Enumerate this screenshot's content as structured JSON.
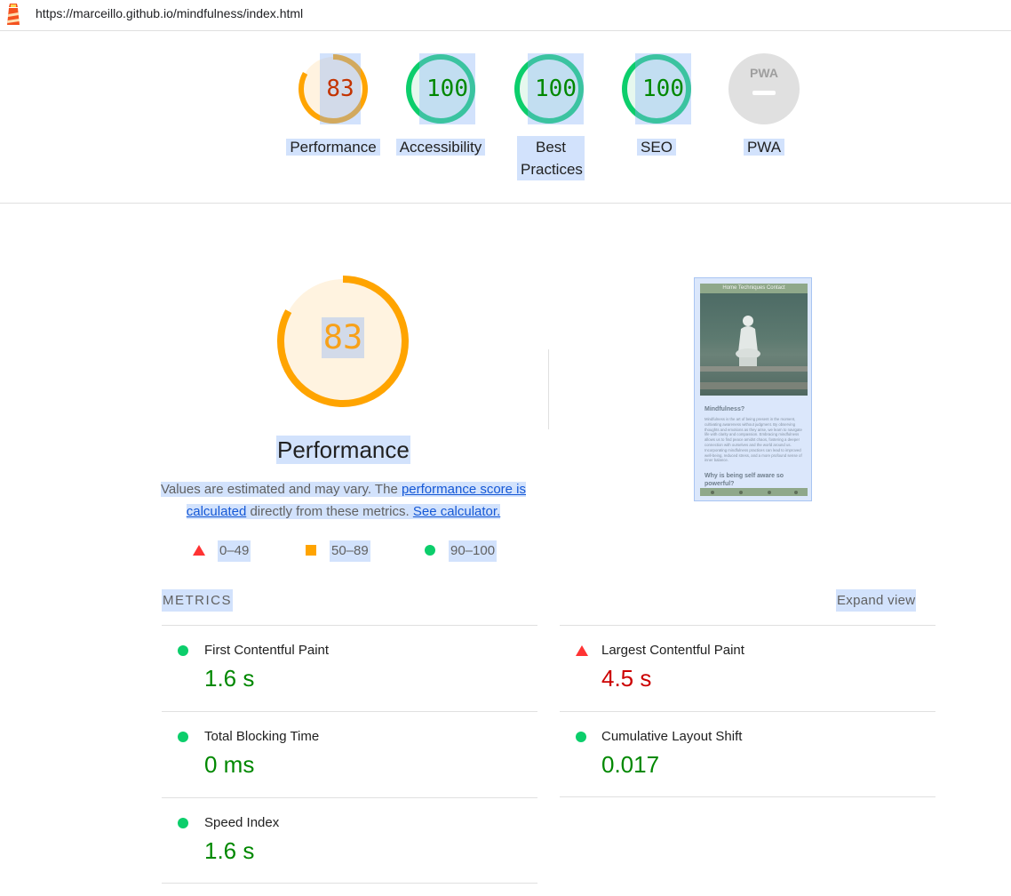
{
  "address_bar": {
    "url": "https://marceillo.github.io/mindfulness/index.html",
    "logo_icon": "lighthouse-icon"
  },
  "gauges": [
    {
      "label": "Performance",
      "score": "83",
      "color": "#ffa400",
      "text_color": "#c33300",
      "fill": "#fff3e0"
    },
    {
      "label": "Accessibility",
      "score": "100",
      "color": "#0cce6b",
      "text_color": "#008800",
      "fill": "#e6f8ee"
    },
    {
      "label": "Best Practices",
      "score": "100",
      "color": "#0cce6b",
      "text_color": "#008800",
      "fill": "#e6f8ee"
    },
    {
      "label": "SEO",
      "score": "100",
      "color": "#0cce6b",
      "text_color": "#008800",
      "fill": "#e6f8ee"
    },
    {
      "label": "PWA",
      "badge_text": "PWA",
      "icon": "pwa-badge-icon"
    }
  ],
  "performance": {
    "score": "83",
    "score_fraction": 0.83,
    "title": "Performance",
    "desc_prefix": "Values are estimated and may vary. The ",
    "link_score": "performance score is calculated",
    "desc_middle": " directly from these metrics. ",
    "link_calc": "See calculator."
  },
  "legend": [
    {
      "range": "0–49",
      "shape": "triangle-icon",
      "color": "#ff3333"
    },
    {
      "range": "50–89",
      "shape": "square-icon",
      "color": "#ffa400"
    },
    {
      "range": "90–100",
      "shape": "circle-icon",
      "color": "#0cce6b"
    }
  ],
  "screenshot": {
    "nav": "Home   Techniques   Contact",
    "heading": "Mindfulness?",
    "paragraph": "Mindfulness is the art of being present in the moment, cultivating awareness without judgment. By observing thoughts and emotions as they arise, we learn to navigate life with clarity and compassion. Embracing mindfulness allows us to find peace amidst chaos, fostering a deeper connection with ourselves and the world around us. Incorporating mindfulness practices can lead to improved well-being, reduced stress, and a more profound sense of inner balance.",
    "subheading": "Why is being self aware so powerful?"
  },
  "metrics": {
    "header": "METRICS",
    "expand_label": "Expand view",
    "items": [
      {
        "name": "First Contentful Paint",
        "value": "1.6 s",
        "status": "pass",
        "color": "#008800"
      },
      {
        "name": "Largest Contentful Paint",
        "value": "4.5 s",
        "status": "fail",
        "color": "#cc0000"
      },
      {
        "name": "Total Blocking Time",
        "value": "0 ms",
        "status": "pass",
        "color": "#008800"
      },
      {
        "name": "Cumulative Layout Shift",
        "value": "0.017",
        "status": "pass",
        "color": "#008800"
      },
      {
        "name": "Speed Index",
        "value": "1.6 s",
        "status": "pass",
        "color": "#008800"
      }
    ]
  }
}
